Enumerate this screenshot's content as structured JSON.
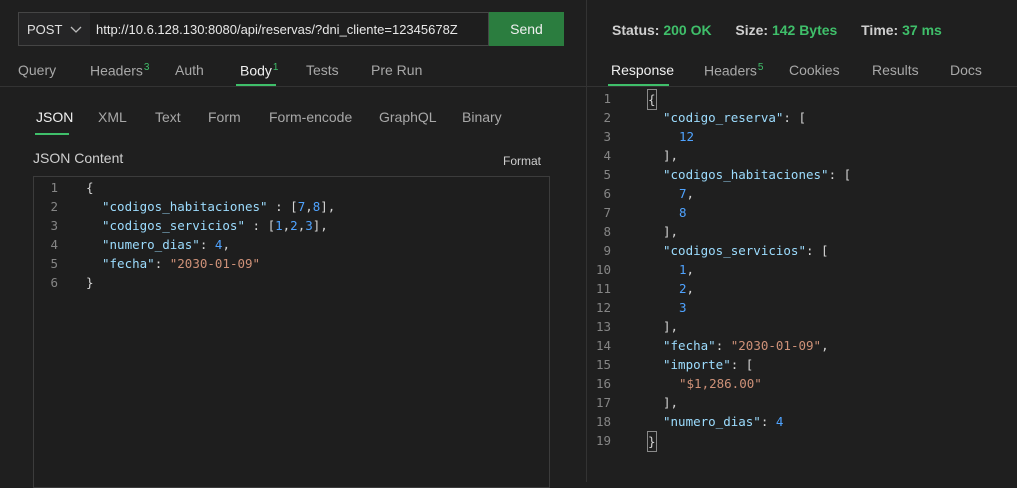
{
  "request": {
    "method": "POST",
    "url": "http://10.6.128.130:8080/api/reservas/?dni_cliente=12345678Z",
    "send_label": "Send"
  },
  "request_tabs": [
    {
      "label": "Query",
      "badge": ""
    },
    {
      "label": "Headers",
      "badge": "3"
    },
    {
      "label": "Auth",
      "badge": ""
    },
    {
      "label": "Body",
      "badge": "1"
    },
    {
      "label": "Tests",
      "badge": ""
    },
    {
      "label": "Pre Run",
      "badge": ""
    }
  ],
  "body_tabs": [
    "JSON",
    "XML",
    "Text",
    "Form",
    "Form-encode",
    "GraphQL",
    "Binary"
  ],
  "json_content": {
    "title": "JSON Content",
    "format_label": "Format",
    "line_numbers": [
      "1",
      "2",
      "3",
      "4",
      "5",
      "6"
    ]
  },
  "response": {
    "status_label": "Status:",
    "status_value": "200 OK",
    "size_label": "Size:",
    "size_value": "142 Bytes",
    "time_label": "Time:",
    "time_value": "37 ms",
    "tabs": [
      {
        "label": "Response",
        "badge": ""
      },
      {
        "label": "Headers",
        "badge": "5"
      },
      {
        "label": "Cookies",
        "badge": ""
      },
      {
        "label": "Results",
        "badge": ""
      },
      {
        "label": "Docs",
        "badge": ""
      }
    ],
    "line_numbers": [
      "1",
      "2",
      "3",
      "4",
      "5",
      "6",
      "7",
      "8",
      "9",
      "10",
      "11",
      "12",
      "13",
      "14",
      "15",
      "16",
      "17",
      "18",
      "19"
    ]
  },
  "colors": {
    "accent_green": "#3fbf6a",
    "send_button": "#2b7d3f",
    "json_key": "#9cdcfe",
    "json_string": "#ce9178",
    "json_number": "#4fa3ff"
  }
}
